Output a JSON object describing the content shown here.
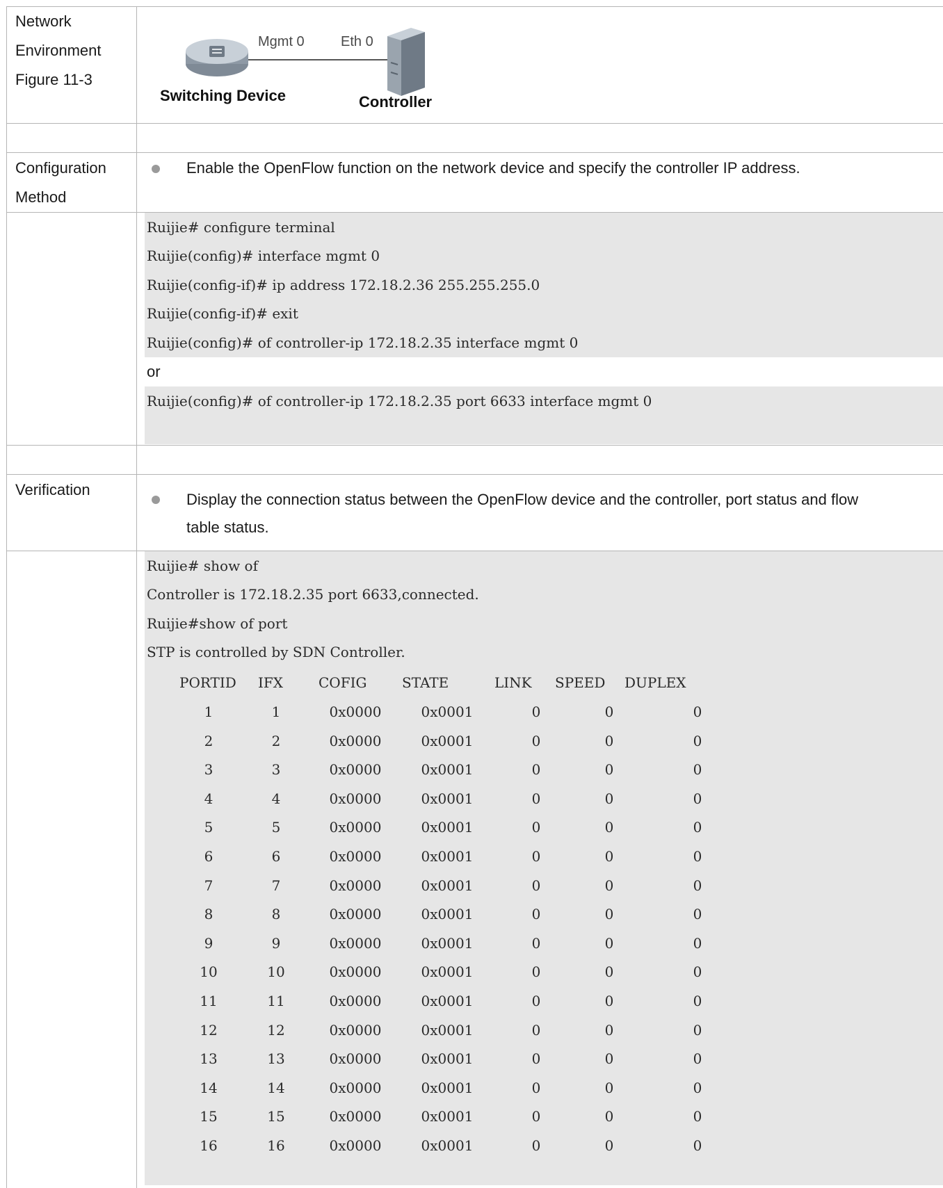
{
  "rows": {
    "network": {
      "label_lines": [
        "Network",
        "Environment",
        "Figure 11-3"
      ],
      "figure": {
        "mgmt_label": "Mgmt 0",
        "eth_label": "Eth 0",
        "switch_caption": "Switching Device",
        "controller_caption": "Controller"
      }
    },
    "configuration": {
      "label_lines": [
        "Configuration",
        "Method"
      ],
      "bullet": "Enable the OpenFlow function on the network device and specify the controller IP address."
    },
    "config_code": {
      "lines": [
        "Ruijie# configure terminal",
        "Ruijie(config)# interface mgmt 0",
        "Ruijie(config-if)# ip address 172.18.2.36 255.255.255.0",
        "Ruijie(config-if)# exit",
        "Ruijie(config)# of controller-ip 172.18.2.35 interface mgmt 0"
      ],
      "or_text": "or",
      "alt_line": "Ruijie(config)# of controller-ip 172.18.2.35 port 6633 interface mgmt 0"
    },
    "verification": {
      "label": "Verification",
      "bullet_line1": "Display the connection status between the OpenFlow device and the controller, port status and flow",
      "bullet_line2": "table status."
    },
    "verify_code": {
      "lines": [
        "Ruijie# show of",
        "Controller is 172.18.2.35 port 6633,connected.",
        "Ruijie#show of port",
        "STP is controlled by SDN Controller."
      ],
      "table_headers": [
        "PORTID",
        "IFX",
        "COFIG",
        "STATE",
        "LINK",
        "SPEED",
        "DUPLEX"
      ],
      "table_rows": [
        [
          "1",
          "1",
          "0x0000",
          "0x0001",
          "0",
          "0",
          "0"
        ],
        [
          "2",
          "2",
          "0x0000",
          "0x0001",
          "0",
          "0",
          "0"
        ],
        [
          "3",
          "3",
          "0x0000",
          "0x0001",
          "0",
          "0",
          "0"
        ],
        [
          "4",
          "4",
          "0x0000",
          "0x0001",
          "0",
          "0",
          "0"
        ],
        [
          "5",
          "5",
          "0x0000",
          "0x0001",
          "0",
          "0",
          "0"
        ],
        [
          "6",
          "6",
          "0x0000",
          "0x0001",
          "0",
          "0",
          "0"
        ],
        [
          "7",
          "7",
          "0x0000",
          "0x0001",
          "0",
          "0",
          "0"
        ],
        [
          "8",
          "8",
          "0x0000",
          "0x0001",
          "0",
          "0",
          "0"
        ],
        [
          "9",
          "9",
          "0x0000",
          "0x0001",
          "0",
          "0",
          "0"
        ],
        [
          "10",
          "10",
          "0x0000",
          "0x0001",
          "0",
          "0",
          "0"
        ],
        [
          "11",
          "11",
          "0x0000",
          "0x0001",
          "0",
          "0",
          "0"
        ],
        [
          "12",
          "12",
          "0x0000",
          "0x0001",
          "0",
          "0",
          "0"
        ],
        [
          "13",
          "13",
          "0x0000",
          "0x0001",
          "0",
          "0",
          "0"
        ],
        [
          "14",
          "14",
          "0x0000",
          "0x0001",
          "0",
          "0",
          "0"
        ],
        [
          "15",
          "15",
          "0x0000",
          "0x0001",
          "0",
          "0",
          "0"
        ],
        [
          "16",
          "16",
          "0x0000",
          "0x0001",
          "0",
          "0",
          "0"
        ]
      ]
    }
  }
}
